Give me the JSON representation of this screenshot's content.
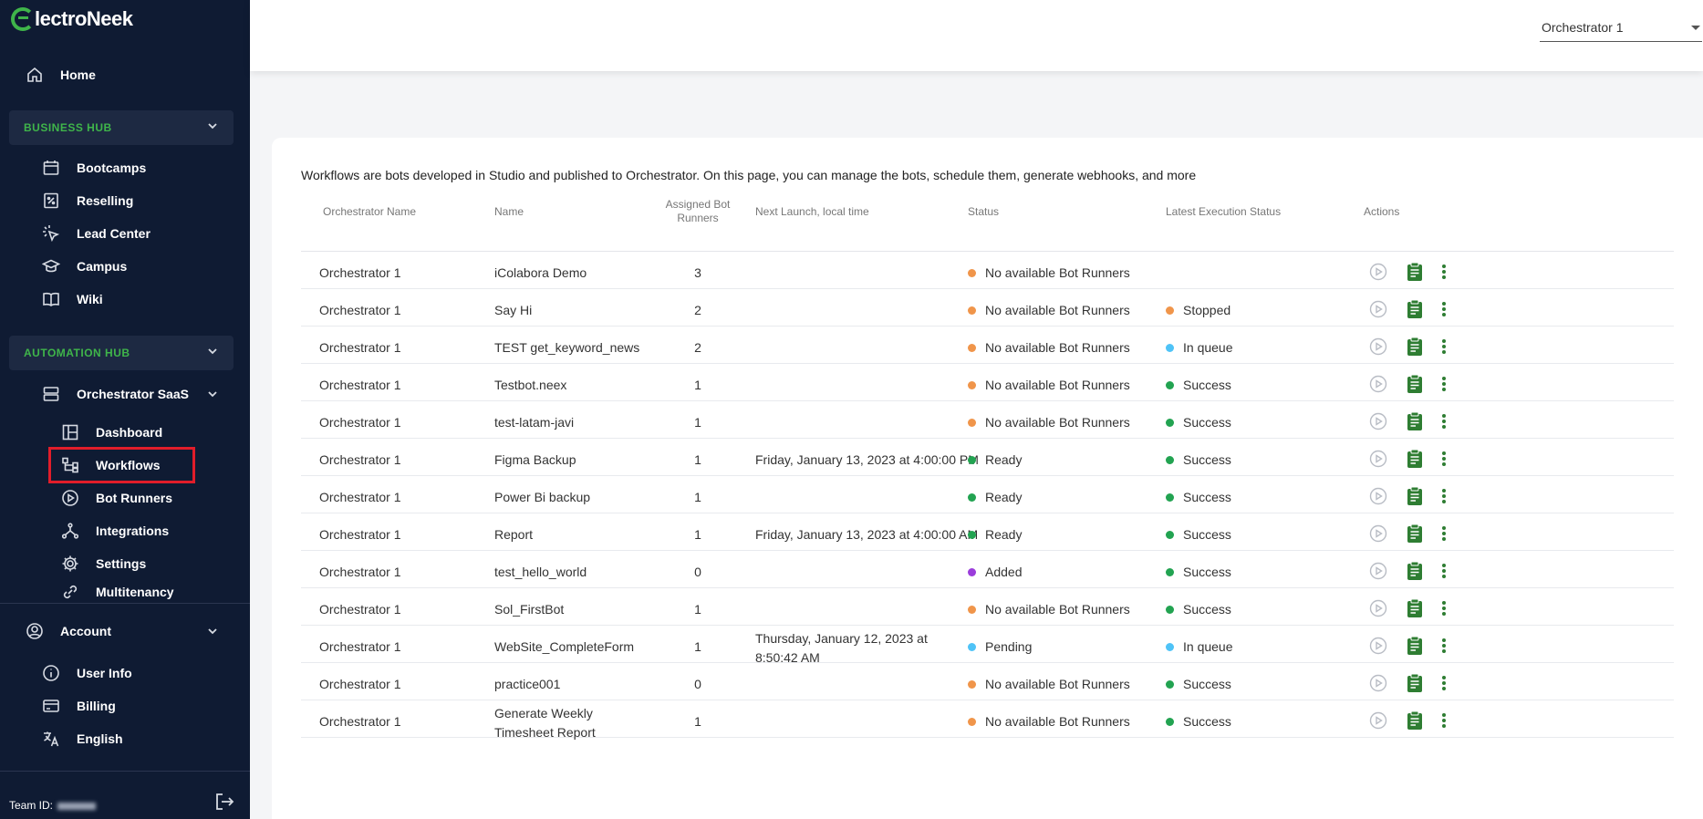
{
  "app": {
    "logo_text": "lectroNeek"
  },
  "sidebar": {
    "home": "Home",
    "business_hub": {
      "label": "BUSINESS HUB",
      "items": [
        "Bootcamps",
        "Reselling",
        "Lead Center",
        "Campus",
        "Wiki"
      ]
    },
    "automation_hub": {
      "label": "AUTOMATION HUB",
      "group": "Orchestrator SaaS",
      "items": [
        "Dashboard",
        "Workflows",
        "Bot Runners",
        "Integrations",
        "Settings",
        "Multitenancy"
      ]
    },
    "account": {
      "label": "Account",
      "items": [
        "User Info",
        "Billing",
        "English"
      ]
    },
    "team_id_label": "Team ID:"
  },
  "topbar": {
    "orchestrator_select": "Orchestrator 1"
  },
  "main": {
    "intro": "Workflows are bots developed in Studio and published to Orchestrator. On this page, you can manage the bots, schedule them, generate webhooks, and more",
    "columns": {
      "orchestrator_name": "Orchestrator Name",
      "name": "Name",
      "assigned_bot_runners": "Assigned Bot Runners",
      "next_launch": "Next Launch, local time",
      "status": "Status",
      "latest_execution_status": "Latest Execution Status",
      "actions": "Actions"
    },
    "rows": [
      {
        "orch": "Orchestrator 1",
        "name": "iColabora Demo",
        "runners": "3",
        "next": "",
        "status": "No available Bot Runners",
        "latest": ""
      },
      {
        "orch": "Orchestrator 1",
        "name": "Say Hi",
        "runners": "2",
        "next": "",
        "status": "No available Bot Runners",
        "latest": "Stopped"
      },
      {
        "orch": "Orchestrator 1",
        "name": "TEST get_keyword_news",
        "runners": "2",
        "next": "",
        "status": "No available Bot Runners",
        "latest": "In queue"
      },
      {
        "orch": "Orchestrator 1",
        "name": "Testbot.neex",
        "runners": "1",
        "next": "",
        "status": "No available Bot Runners",
        "latest": "Success"
      },
      {
        "orch": "Orchestrator 1",
        "name": "test-latam-javi",
        "runners": "1",
        "next": "",
        "status": "No available Bot Runners",
        "latest": "Success"
      },
      {
        "orch": "Orchestrator 1",
        "name": "Figma Backup",
        "runners": "1",
        "next": "Friday, January 13, 2023 at 4:00:00 PM",
        "status": "Ready",
        "latest": "Success"
      },
      {
        "orch": "Orchestrator 1",
        "name": "Power Bi backup",
        "runners": "1",
        "next": "",
        "status": "Ready",
        "latest": "Success"
      },
      {
        "orch": "Orchestrator 1",
        "name": "Report",
        "runners": "1",
        "next": "Friday, January 13, 2023 at 4:00:00 AM",
        "status": "Ready",
        "latest": "Success"
      },
      {
        "orch": "Orchestrator 1",
        "name": "test_hello_world",
        "runners": "0",
        "next": "",
        "status": "Added",
        "latest": "Success"
      },
      {
        "orch": "Orchestrator 1",
        "name": "Sol_FirstBot",
        "runners": "1",
        "next": "",
        "status": "No available Bot Runners",
        "latest": "Success"
      },
      {
        "orch": "Orchestrator 1",
        "name": "WebSite_CompleteForm",
        "runners": "1",
        "next": "Thursday, January 12, 2023 at 8:50:42 AM",
        "status": "Pending",
        "latest": "In queue"
      },
      {
        "orch": "Orchestrator 1",
        "name": "practice001",
        "runners": "0",
        "next": "",
        "status": "No available Bot Runners",
        "latest": "Success"
      },
      {
        "orch": "Orchestrator 1",
        "name": "Generate Weekly Timesheet Report",
        "runners": "1",
        "next": "",
        "status": "No available Bot Runners",
        "latest": "Success"
      }
    ]
  },
  "colors": {
    "sidebar_bg": "#0f1b33",
    "accent_green": "#3fb54a",
    "highlight_red": "#e11d2a",
    "status_orange": "#f0954a",
    "status_green": "#22a351",
    "status_blue": "#4fc3f7",
    "status_purple": "#9b3ddb"
  }
}
